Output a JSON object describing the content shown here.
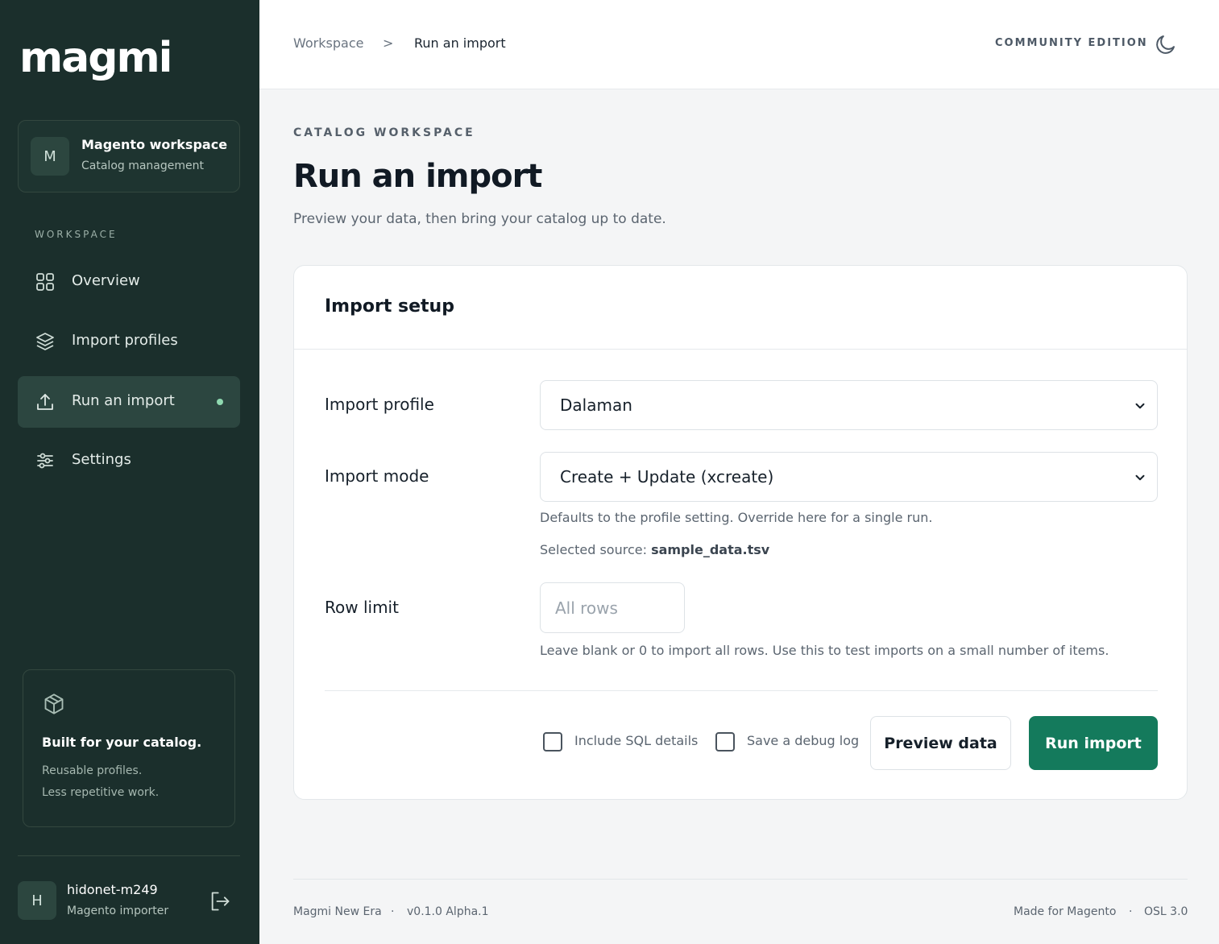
{
  "sidebar": {
    "logo": "magmi",
    "workspace": {
      "avatar": "M",
      "name": "Magento workspace",
      "subtitle": "Catalog management"
    },
    "nav_label": "WORKSPACE",
    "items": [
      {
        "label": "Overview",
        "icon": "grid-icon"
      },
      {
        "label": "Import profiles",
        "icon": "layers-icon"
      },
      {
        "label": "Run an import",
        "icon": "upload-icon",
        "active": true
      },
      {
        "label": "Settings",
        "icon": "sliders-icon"
      }
    ],
    "promo": {
      "title": "Built for your catalog.",
      "line1": "Reusable profiles.",
      "line2": "Less repetitive work."
    },
    "user": {
      "avatar": "H",
      "name": "hidonet-m249",
      "role": "Magento importer"
    }
  },
  "topbar": {
    "breadcrumb": [
      "Workspace",
      "Run an import"
    ],
    "breadcrumb_sep": ">",
    "edition": "COMMUNITY EDITION"
  },
  "page": {
    "eyebrow": "CATALOG WORKSPACE",
    "title": "Run an import",
    "subtitle": "Preview your data, then bring your catalog up to date."
  },
  "card": {
    "title": "Import setup",
    "profile": {
      "label": "Import profile",
      "value": "Dalaman"
    },
    "mode": {
      "label": "Import mode",
      "value": "Create + Update (xcreate)",
      "hint": "Defaults to the profile setting. Override here for a single run."
    },
    "source": {
      "prefix": "Selected source: ",
      "file": "sample_data.tsv"
    },
    "row_limit": {
      "label": "Row limit",
      "placeholder": "All rows",
      "hint": "Leave blank or 0 to import all rows. Use this to test imports on a small number of items."
    },
    "options": {
      "sql": "Include SQL details",
      "debug": "Save a debug log"
    },
    "buttons": {
      "preview": "Preview data",
      "run": "Run import"
    }
  },
  "footer": {
    "left": [
      "Magmi New Era",
      "v0.1.0 Alpha.1"
    ],
    "right": [
      "Made for Magento",
      "OSL 3.0"
    ],
    "sep": "·"
  },
  "colors": {
    "sidebar_bg": "#1b2f2c",
    "accent": "#147a5c",
    "active_dot": "#8fd9b0"
  }
}
